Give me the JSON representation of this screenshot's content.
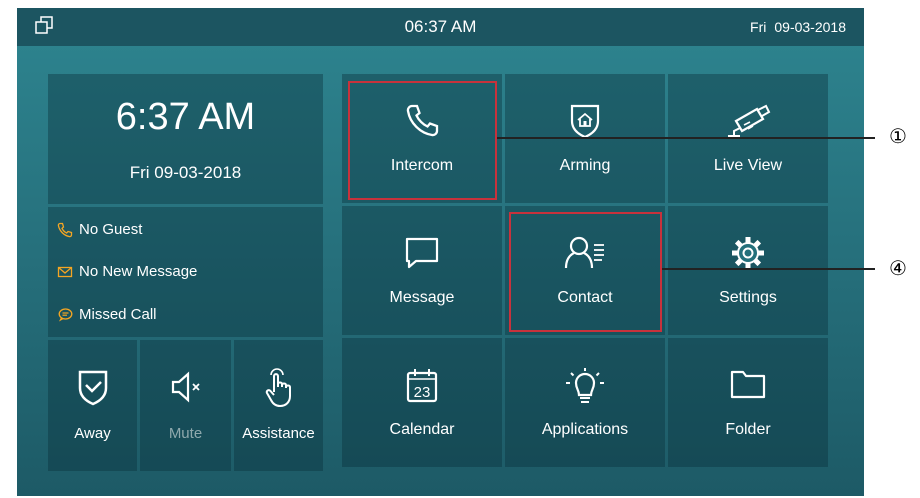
{
  "statusbar": {
    "time": "06:37 AM",
    "day": "Fri",
    "date": "09-03-2018"
  },
  "clock": {
    "time": "6:37 AM",
    "date": "Fri 09-03-2018"
  },
  "notices": [
    {
      "icon": "phone-icon",
      "label": "No Guest"
    },
    {
      "icon": "envelope-icon",
      "label": "No New Message"
    },
    {
      "icon": "chat-bubble-icon",
      "label": "Missed Call"
    }
  ],
  "quick_actions": [
    {
      "icon": "shield-check-icon",
      "label": "Away"
    },
    {
      "icon": "speaker-mute-icon",
      "label": "Mute"
    },
    {
      "icon": "hand-touch-icon",
      "label": "Assistance"
    }
  ],
  "tiles": [
    {
      "icon": "phone-handset-icon",
      "label": "Intercom"
    },
    {
      "icon": "shield-home-icon",
      "label": "Arming"
    },
    {
      "icon": "cctv-camera-icon",
      "label": "Live View"
    },
    {
      "icon": "message-box-icon",
      "label": "Message"
    },
    {
      "icon": "contact-person-icon",
      "label": "Contact"
    },
    {
      "icon": "gear-icon",
      "label": "Settings"
    },
    {
      "icon": "calendar-icon",
      "label": "Calendar",
      "calendar_day": "23"
    },
    {
      "icon": "lightbulb-icon",
      "label": "Applications"
    },
    {
      "icon": "folder-icon",
      "label": "Folder"
    }
  ],
  "callouts": [
    "①",
    "④"
  ],
  "colors": {
    "accent_orange": "#f5a623",
    "highlight_red": "#c8323c",
    "status_bar": "#1c5561"
  }
}
